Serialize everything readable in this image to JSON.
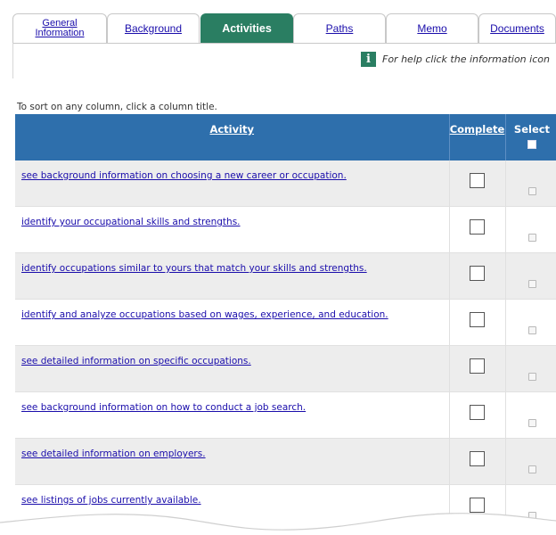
{
  "tabs": [
    {
      "label_line1": "General",
      "label_line2": "Information"
    },
    {
      "label": "Background"
    },
    {
      "label": "Activities"
    },
    {
      "label": "Paths"
    },
    {
      "label": "Memo"
    },
    {
      "label": "Documents"
    }
  ],
  "help": {
    "icon_glyph": "i",
    "text": "For help click the information icon"
  },
  "sort_hint": "To sort on any column, click a column title.",
  "table": {
    "headers": {
      "activity": "Activity",
      "complete": "Complete",
      "select": "Select"
    },
    "rows": [
      {
        "activity": "see background information on choosing a new career or occupation."
      },
      {
        "activity": "identify your occupational skills and strengths."
      },
      {
        "activity": "identify occupations similar to yours that match your skills and strengths."
      },
      {
        "activity": "identify and analyze occupations based on wages, experience, and education."
      },
      {
        "activity": "see detailed information on specific occupations."
      },
      {
        "activity": "see background information on how to conduct a job search."
      },
      {
        "activity": "see detailed information on employers."
      },
      {
        "activity": "see listings of jobs currently available."
      }
    ]
  },
  "colors": {
    "active_tab": "#2a7e62",
    "header_blue": "#2e6fac",
    "link": "#1a0dab"
  }
}
